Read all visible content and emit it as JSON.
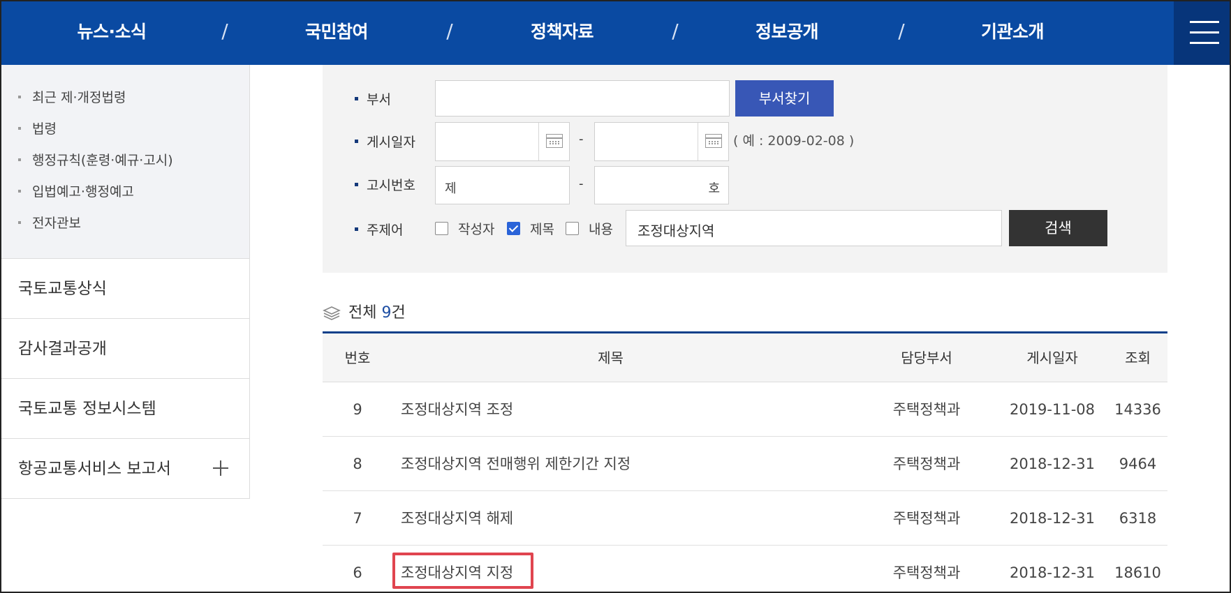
{
  "nav": {
    "items": [
      "뉴스·소식",
      "국민참여",
      "정책자료",
      "정보공개",
      "기관소개"
    ],
    "separator": "/",
    "menu_icon": "hamburger-icon"
  },
  "sidebar": {
    "sub_items": [
      "최근 제·개정법령",
      "법령",
      "행정규칙(훈령·예규·고시)",
      "입법예고·행정예고",
      "전자관보"
    ],
    "links": [
      "국토교통상식",
      "감사결과공개",
      "국토교통 정보시스템",
      "항공교통서비스 보고서"
    ]
  },
  "search": {
    "dept_label": "부서",
    "dept_value": "",
    "dept_button": "부서찾기",
    "date_label": "게시일자",
    "date_from": "",
    "date_to": "",
    "date_dash": "-",
    "date_hint": "( 예 : 2009-02-08 )",
    "notice_label": "고시번호",
    "notice_prefix": "제",
    "notice_suffix": "호",
    "notice_dash": "-",
    "keyword_label": "주제어",
    "options": [
      {
        "label": "작성자",
        "checked": false
      },
      {
        "label": "제목",
        "checked": true
      },
      {
        "label": "내용",
        "checked": false
      }
    ],
    "keyword_value": "조정대상지역",
    "search_button": "검색"
  },
  "results": {
    "total_prefix": "전체 ",
    "total_count": "9",
    "total_suffix": "건",
    "columns": [
      "번호",
      "제목",
      "담당부서",
      "게시일자",
      "조회"
    ],
    "rows": [
      {
        "no": "9",
        "title": "조정대상지역 조정",
        "dept": "주택정책과",
        "date": "2019-11-08",
        "views": "14336"
      },
      {
        "no": "8",
        "title": "조정대상지역 전매행위 제한기간 지정",
        "dept": "주택정책과",
        "date": "2018-12-31",
        "views": "9464"
      },
      {
        "no": "7",
        "title": "조정대상지역 해제",
        "dept": "주택정책과",
        "date": "2018-12-31",
        "views": "6318"
      },
      {
        "no": "6",
        "title": "조정대상지역 지정",
        "dept": "주택정책과",
        "date": "2018-12-31",
        "views": "18610"
      }
    ]
  },
  "colors": {
    "nav_bg": "#0a4aa2",
    "accent_blue": "#3857b6",
    "highlight": "#e0454f"
  }
}
